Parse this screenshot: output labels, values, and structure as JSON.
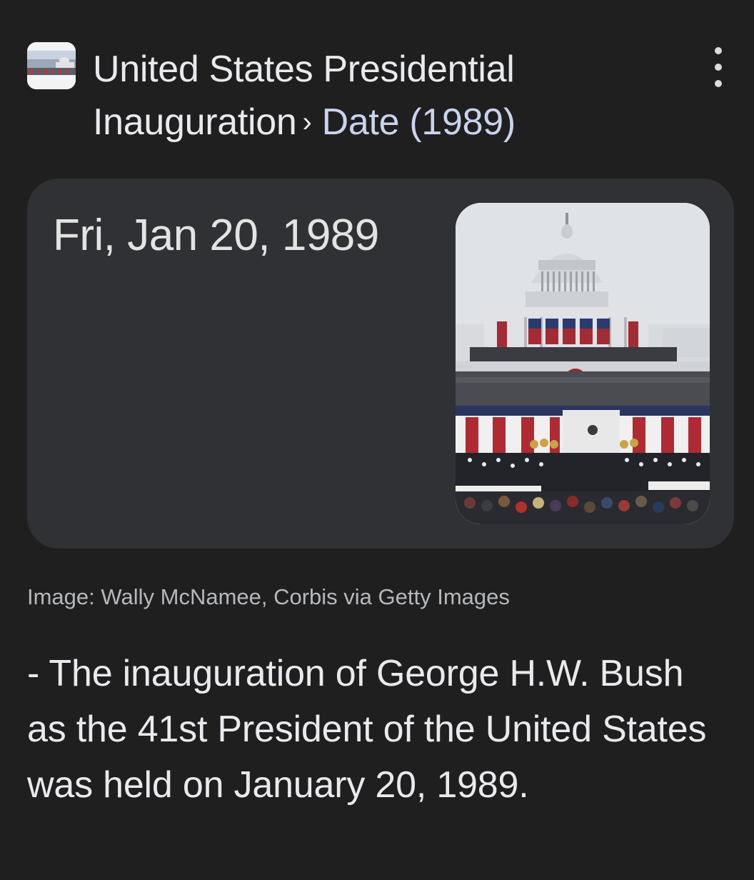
{
  "header": {
    "title": "United States Presidential Inauguration",
    "separator": "›",
    "current": "Date (1989)",
    "more_icon": "more-vertical-icon"
  },
  "card": {
    "date": "Fri, Jan 20, 1989",
    "image_icon": "capitol-inauguration-photo"
  },
  "caption": "Image: Wally McNamee, Corbis via Getty Images",
  "description": "- The inauguration of George H.W. Bush as the 41st President of the United States was held on January 20, 1989.",
  "colors": {
    "background": "#1f1f1f",
    "card": "#303134",
    "accent_link": "#c9d3ee"
  }
}
